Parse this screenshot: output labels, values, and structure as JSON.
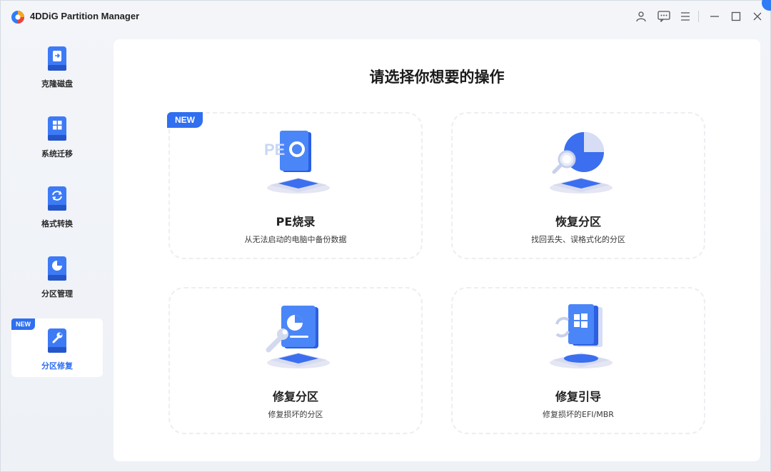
{
  "window": {
    "title": "4DDiG Partition Manager",
    "icons": [
      "user-icon",
      "feedback-icon",
      "menu-icon",
      "minimize-icon",
      "maximize-icon",
      "close-icon"
    ]
  },
  "sidebar": {
    "items": [
      {
        "label": "克隆磁盘",
        "icon": "clone-disk-icon",
        "active": false,
        "badge": ""
      },
      {
        "label": "系统迁移",
        "icon": "system-migrate-icon",
        "active": false,
        "badge": ""
      },
      {
        "label": "格式转换",
        "icon": "format-convert-icon",
        "active": false,
        "badge": ""
      },
      {
        "label": "分区管理",
        "icon": "partition-manage-icon",
        "active": false,
        "badge": ""
      },
      {
        "label": "分区修复",
        "icon": "partition-repair-icon",
        "active": true,
        "badge": "NEW"
      }
    ]
  },
  "main": {
    "title": "请选择你想要的操作",
    "cards": [
      {
        "title": "PE烧录",
        "desc": "从无法启动的电脑中备份数据",
        "badge": "NEW",
        "icon": "pe-burn-icon"
      },
      {
        "title": "恢复分区",
        "desc": "找回丢失、误格式化的分区",
        "badge": "",
        "icon": "recover-partition-icon"
      },
      {
        "title": "修复分区",
        "desc": "修复损坏的分区",
        "badge": "",
        "icon": "repair-partition-icon"
      },
      {
        "title": "修复引导",
        "desc": "修复损坏的EFI/MBR",
        "badge": "",
        "icon": "repair-boot-icon"
      }
    ]
  },
  "colors": {
    "accent": "#2f6ff0",
    "active_text": "#2b6cf0",
    "panel": "#ffffff",
    "background": "#eef1f6"
  }
}
